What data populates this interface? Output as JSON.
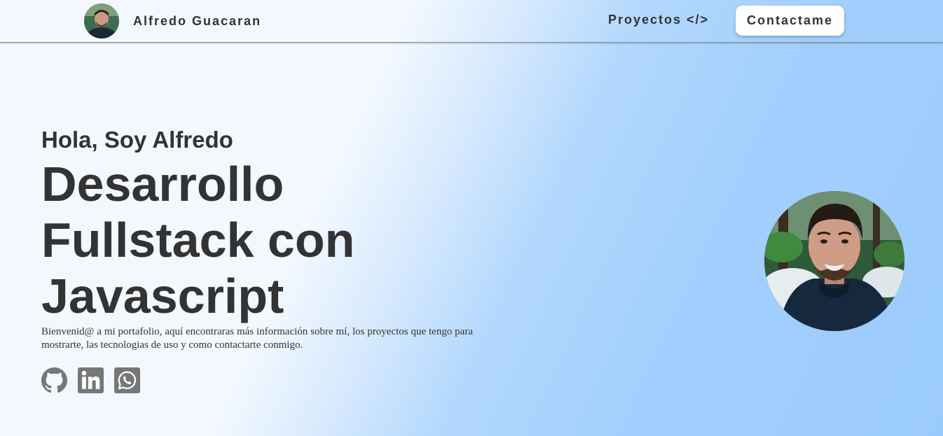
{
  "nav": {
    "brand_name": "Alfredo Guacaran",
    "projects_label": "Proyectos </>",
    "contact_label": "Contactame"
  },
  "hero": {
    "greeting": "Hola, Soy Alfredo",
    "headline": "Desarrollo Fullstack con Javascript",
    "intro": "Bienvenid@ a mi portafolio, aquí encontraras más información sobre mí, los proyectos que tengo para mostrarte, las tecnologias de uso y como contactarte conmigo."
  },
  "socials": [
    {
      "icon": "github-icon"
    },
    {
      "icon": "linkedin-icon"
    },
    {
      "icon": "whatsapp-icon"
    }
  ],
  "colors": {
    "text": "#333333",
    "icon": "#777777",
    "gradient_light": "#f2f8fe",
    "gradient_blue": "#9bcbfc",
    "button_bg": "#ffffff"
  }
}
